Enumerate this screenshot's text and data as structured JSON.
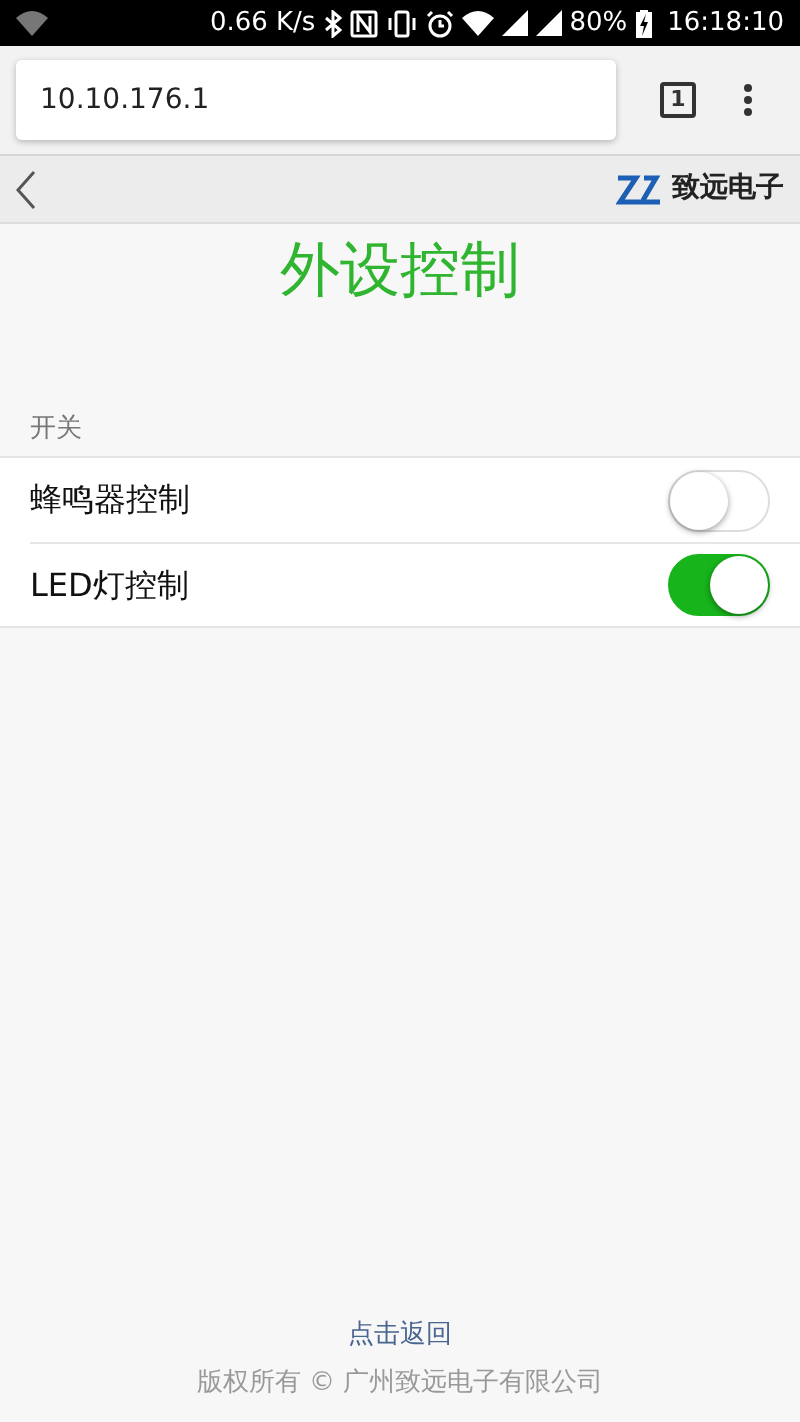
{
  "status_bar": {
    "speed": "0.66 K/s",
    "battery": "80%",
    "time": "16:18:10"
  },
  "browser": {
    "url": "10.10.176.1",
    "tab_count": "1"
  },
  "header": {
    "brand": "致远电子"
  },
  "title": "外设控制",
  "section": {
    "label": "开关",
    "items": [
      {
        "label": "蜂鸣器控制",
        "on": false
      },
      {
        "label": "LED灯控制",
        "on": true
      }
    ]
  },
  "footer": {
    "link": "点击返回",
    "copyright": "版权所有 © 广州致远电子有限公司"
  }
}
